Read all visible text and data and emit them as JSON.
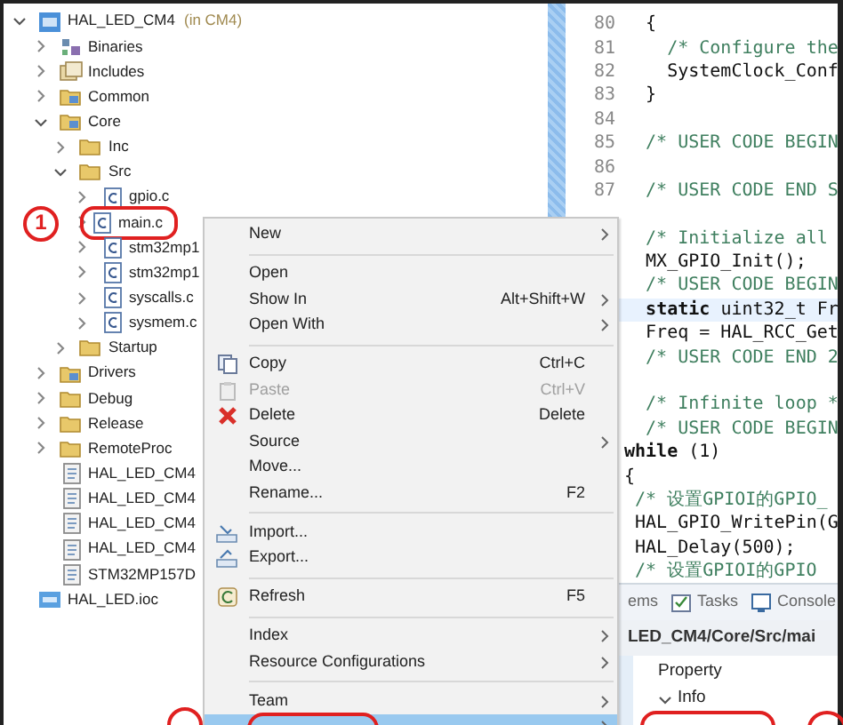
{
  "project_tree": [
    {
      "label": "HAL_LED_CM4",
      "suffix": "(in CM4)",
      "kind": "project",
      "expanded": true,
      "children": [
        {
          "label": "Binaries",
          "kind": "binaries",
          "expanded": false
        },
        {
          "label": "Includes",
          "kind": "includes",
          "expanded": false
        },
        {
          "label": "Common",
          "kind": "source-folder",
          "expanded": false
        },
        {
          "label": "Core",
          "kind": "source-folder",
          "expanded": true,
          "children": [
            {
              "label": "Inc",
              "kind": "folder",
              "expanded": false
            },
            {
              "label": "Src",
              "kind": "folder",
              "expanded": true,
              "children": [
                {
                  "label": "gpio.c",
                  "kind": "c-file",
                  "expanded": false
                },
                {
                  "label": "main.c",
                  "kind": "c-file",
                  "expanded": false,
                  "circled": true
                },
                {
                  "label": "stm32mp1",
                  "kind": "c-file",
                  "expanded": false
                },
                {
                  "label": "stm32mp1",
                  "kind": "c-file",
                  "expanded": false
                },
                {
                  "label": "syscalls.c",
                  "kind": "c-file",
                  "expanded": false
                },
                {
                  "label": "sysmem.c",
                  "kind": "c-file",
                  "expanded": false
                }
              ]
            },
            {
              "label": "Startup",
              "kind": "folder",
              "expanded": false
            }
          ]
        },
        {
          "label": "Drivers",
          "kind": "source-folder",
          "expanded": false
        },
        {
          "label": "Debug",
          "kind": "folder",
          "expanded": false
        },
        {
          "label": "Release",
          "kind": "folder",
          "expanded": false
        },
        {
          "label": "RemoteProc",
          "kind": "folder",
          "expanded": false
        },
        {
          "label": "HAL_LED_CM4",
          "kind": "launch-file"
        },
        {
          "label": "HAL_LED_CM4",
          "kind": "launch-file"
        },
        {
          "label": "HAL_LED_CM4",
          "kind": "launch-file"
        },
        {
          "label": "HAL_LED_CM4",
          "kind": "launch-file"
        },
        {
          "label": "STM32MP157D",
          "kind": "linker-file"
        }
      ]
    },
    {
      "label": "HAL_LED.ioc",
      "kind": "ioc"
    }
  ],
  "annotations": [
    {
      "label": "1"
    }
  ],
  "editor": {
    "lines": [
      {
        "number": "80",
        "text": "  {",
        "current": false
      },
      {
        "number": "81",
        "text": "    /* Configure the",
        "kind": "comment",
        "current": false
      },
      {
        "number": "82",
        "text": "    SystemClock_Conf",
        "current": false
      },
      {
        "number": "83",
        "text": "  }",
        "current": false
      },
      {
        "number": "84",
        "current": false
      },
      {
        "number": "85",
        "text": "  /* USER CODE BEGIN",
        "kind": "comment",
        "current": false
      },
      {
        "number": "86",
        "current": false
      },
      {
        "number": "87",
        "text": "  /* USER CODE END S",
        "kind": "comment",
        "current": false
      },
      {
        "current": false
      },
      {
        "text": "  /* Initialize all",
        "kind": "comment",
        "current": false
      },
      {
        "text": "  MX_GPIO_Init();",
        "current": false
      },
      {
        "text": "  /* USER CODE BEGIN",
        "kind": "comment",
        "current": false
      },
      {
        "text": "  **static** uint32_t Fr",
        "current": true
      },
      {
        "text": "  Freq = HAL_RCC_Get",
        "current": false
      },
      {
        "text": "  /* USER CODE END 2",
        "kind": "comment",
        "current": false
      },
      {
        "current": false
      },
      {
        "text": "  /* Infinite loop *",
        "kind": "comment",
        "current": false
      },
      {
        "text": "  /* USER CODE BEGIN",
        "kind": "comment",
        "current": false
      },
      {
        "text": "**while** (1)",
        "current": false
      },
      {
        "text": "{",
        "current": false
      },
      {
        "text": " /* 设置GPIOI的GPIO_",
        "kind": "comment",
        "current": false
      },
      {
        "text": " HAL_GPIO_WritePin(G",
        "current": false
      },
      {
        "text": " HAL_Delay(500);",
        "current": false
      },
      {
        "text": " /* 设置GPIOI的GPIO",
        "kind": "comment",
        "current": false
      }
    ]
  },
  "bottom_panel": {
    "tabs": [
      {
        "label": "ems"
      },
      {
        "label": "Tasks"
      },
      {
        "label": "Console"
      }
    ],
    "path": "LED_CM4/Core/Src/mai",
    "property_header": "Property",
    "section": "Info"
  },
  "context_menu": [
    {
      "kind": "item",
      "label": "New",
      "submenu": true,
      "disabled": false,
      "selected": false
    },
    {
      "kind": "separator"
    },
    {
      "kind": "item",
      "label": "Open",
      "submenu": false,
      "disabled": false,
      "selected": false
    },
    {
      "kind": "item",
      "label": "Show In",
      "shortcut": "Alt+Shift+W",
      "submenu": true,
      "disabled": false,
      "selected": false
    },
    {
      "kind": "item",
      "label": "Open With",
      "submenu": true,
      "disabled": false,
      "selected": false
    },
    {
      "kind": "separator"
    },
    {
      "kind": "item",
      "label": "Copy",
      "shortcut": "Ctrl+C",
      "submenu": false,
      "disabled": false,
      "selected": false
    },
    {
      "kind": "item",
      "label": "Paste",
      "shortcut": "Ctrl+V",
      "submenu": false,
      "disabled": true,
      "selected": false
    },
    {
      "kind": "item",
      "label": "Delete",
      "shortcut": "Delete",
      "submenu": false,
      "disabled": false,
      "selected": false
    },
    {
      "kind": "item",
      "label": "Source",
      "submenu": true,
      "disabled": false,
      "selected": false
    },
    {
      "kind": "item",
      "label": "Move...",
      "submenu": false,
      "disabled": false,
      "selected": false
    },
    {
      "kind": "item",
      "label": "Rename...",
      "shortcut": "F2",
      "submenu": false,
      "disabled": false,
      "selected": false
    },
    {
      "kind": "separator"
    },
    {
      "kind": "item",
      "label": "Import...",
      "submenu": false,
      "disabled": false,
      "selected": false
    },
    {
      "kind": "item",
      "label": "Export...",
      "submenu": false,
      "disabled": false,
      "selected": false
    },
    {
      "kind": "separator"
    },
    {
      "kind": "item",
      "label": "Refresh",
      "shortcut": "F5",
      "submenu": false,
      "disabled": false,
      "selected": false
    },
    {
      "kind": "separator"
    },
    {
      "kind": "item",
      "label": "Index",
      "submenu": true,
      "disabled": false,
      "selected": false
    },
    {
      "kind": "item",
      "label": "Resource Configurations",
      "submenu": true,
      "disabled": false,
      "selected": false
    },
    {
      "kind": "separator"
    },
    {
      "kind": "item",
      "label": "Team",
      "submenu": true,
      "disabled": false,
      "selected": false
    },
    {
      "kind": "item",
      "submenu": true,
      "disabled": false,
      "selected": true,
      "circled": true
    }
  ]
}
